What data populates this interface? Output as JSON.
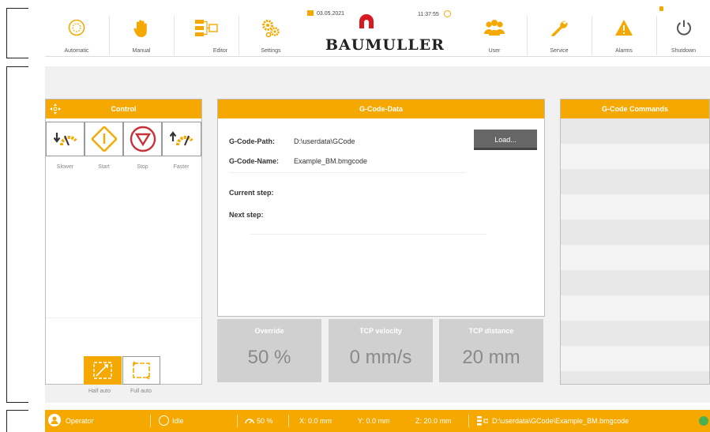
{
  "nav": {
    "items": [
      {
        "label": "Automatic",
        "icon": "automatic-icon"
      },
      {
        "label": "Manual",
        "icon": "hand-icon"
      },
      {
        "label": "Editor",
        "icon": "editor-icon"
      },
      {
        "label": "Settings",
        "icon": "gears-icon"
      },
      {
        "label": "User",
        "icon": "users-icon"
      },
      {
        "label": "Service",
        "icon": "wrench-icon"
      },
      {
        "label": "Alarms",
        "icon": "warning-icon"
      },
      {
        "label": "Shutdown",
        "icon": "power-icon"
      }
    ],
    "date": "03.05.2021",
    "time": "11:37:55",
    "logo": "BAUMULLER"
  },
  "control": {
    "title": "Control",
    "buttons": [
      {
        "label": "Slower"
      },
      {
        "label": "Start"
      },
      {
        "label": "Stop"
      },
      {
        "label": "Faster"
      }
    ],
    "modes": [
      {
        "label": "Half auto",
        "active": true
      },
      {
        "label": "Full auto",
        "active": false
      }
    ]
  },
  "gcode_data": {
    "title": "G-Code-Data",
    "path_label": "G-Code-Path:",
    "path_value": "D:\\userdata\\GCode",
    "name_label": "G-Code-Name:",
    "name_value": "Example_BM.bmgcode",
    "current_label": "Current step:",
    "next_label": "Next step:",
    "load_label": "Load..."
  },
  "tiles": [
    {
      "title": "Override",
      "value": "50 %"
    },
    {
      "title": "TCP velocity",
      "value": "0 mm/s"
    },
    {
      "title": "TCP distance",
      "value": "20 mm"
    }
  ],
  "commands": {
    "title": "G-Code Commands"
  },
  "status": {
    "user": "Operator",
    "state": "Idle",
    "override": "50 %",
    "x": "X:  0.0 mm",
    "y": "Y:  0.0 mm",
    "z": "Z:  20.0 mm",
    "file": "D:\\userdata\\GCode\\Example_BM.bmgcode"
  },
  "colors": {
    "accent": "#f5a800",
    "logo_red": "#d71920",
    "stop_red": "#c8313a"
  }
}
